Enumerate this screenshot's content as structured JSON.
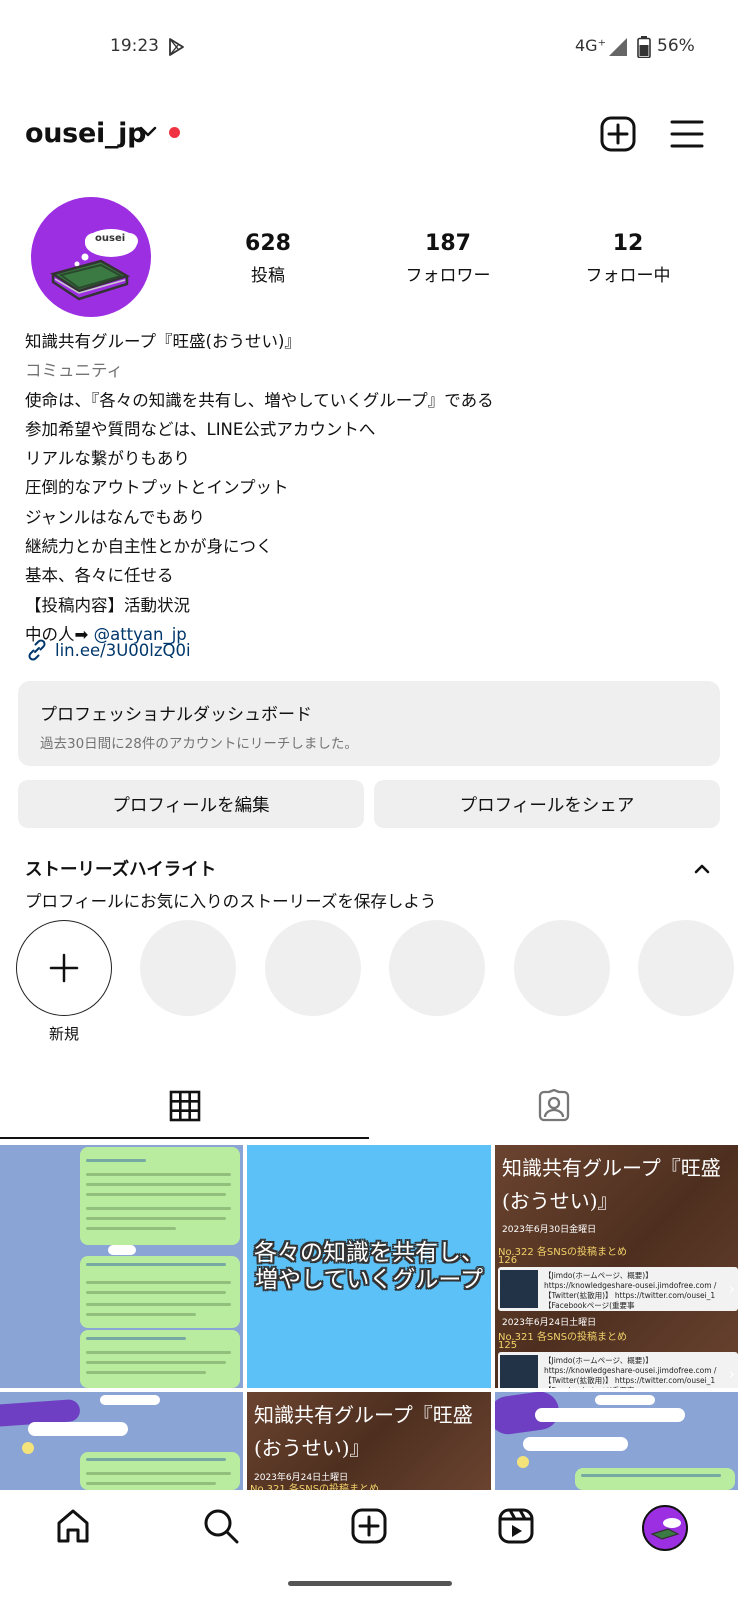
{
  "status_bar": {
    "time": "19:23",
    "network": "4G⁺",
    "battery": "56%"
  },
  "header": {
    "username": "ousei_jp"
  },
  "profile": {
    "avatar_text": "ousei",
    "stats": [
      {
        "value": "628",
        "label": "投稿"
      },
      {
        "value": "187",
        "label": "フォロワー"
      },
      {
        "value": "12",
        "label": "フォロー中"
      }
    ],
    "bio": {
      "name": "知識共有グループ『旺盛(おうせい)』",
      "category": "コミュニティ",
      "lines": [
        "使命は、『各々の知識を共有し、増やしていくグループ』である",
        "参加希望や質問などは、LINE公式アカウントへ",
        "リアルな繋がりもあり",
        "圧倒的なアウトプットとインプット",
        "ジャンルはなんでもあり",
        "継続力とか自主性とかが身につく",
        "基本、各々に任せる",
        "【投稿内容】活動状況"
      ],
      "owner_prefix": "中の人➡ ",
      "owner_handle": "@attyan_jp",
      "link": "lin.ee/3U00lzQ0i"
    }
  },
  "dashboard": {
    "title": "プロフェッショナルダッシュボード",
    "subtitle": "過去30日間に28件のアカウントにリーチしました。"
  },
  "buttons": {
    "edit": "プロフィールを編集",
    "share": "プロフィールをシェア"
  },
  "highlights": {
    "title": "ストーリーズハイライト",
    "subtitle": "プロフィールにお気に入りのストーリーズを保存しよう",
    "new_label": "新規"
  },
  "grid": {
    "blue_post_text_1": "各々の知識を共有し、",
    "blue_post_text_2": "増やしていくグループ",
    "brown_title": "知識共有グループ『旺盛(おうせい)』",
    "brown_a": {
      "date1": "2023年6月30日金曜日",
      "entry1": "No.322 各SNSの投稿まとめ",
      "count1": "126",
      "date2": "2023年6月24日土曜日",
      "entry2": "No.321 各SNSの投稿まとめ",
      "count2": "125",
      "card_text": "【Jimdo(ホームページ、概要)】 https://knowledgeshare-ousei.jimdofree.com / 【Twitter(拡散用)】 https://twitter.com/ousei_1 【Facebookページ(重要事"
    },
    "brown_b": {
      "date1": "2023年6月24日土曜日",
      "entry1": "No.321 各SNSの投稿まとめ"
    }
  },
  "colors": {
    "accent_purple": "#9d2fe2",
    "notification_dot": "#ef3340",
    "link_blue": "#00376b",
    "post_blue": "#5bc1f6"
  }
}
